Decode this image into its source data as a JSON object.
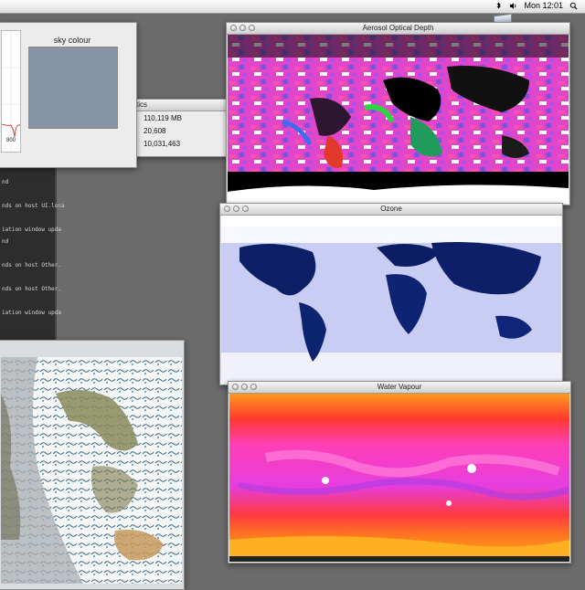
{
  "menubar": {
    "time": "Mon 12:01",
    "icons": [
      "bluetooth-icon",
      "volume-icon",
      "spotlight-icon"
    ]
  },
  "sky_window": {
    "title": "sky colour",
    "axis_tick": "800",
    "swatch_color": "#8494a6"
  },
  "stats_window": {
    "title_fragment": "tics",
    "rows": [
      "110,119 MB",
      "20,608",
      "10,031,463"
    ]
  },
  "terminal": {
    "header": "ay",
    "lines": [
      "nd",
      "",
      "nds on host UI.loca",
      "",
      "iation window upda",
      "nd",
      "",
      "nds on host Other.",
      "",
      "nds on host Other.",
      "",
      "iation window upda",
      ""
    ]
  },
  "windows": {
    "aerosol": {
      "title": "Aerosol Optical Depth"
    },
    "ozone": {
      "title": "Ozone"
    },
    "water": {
      "title": "Water Vapour"
    }
  }
}
